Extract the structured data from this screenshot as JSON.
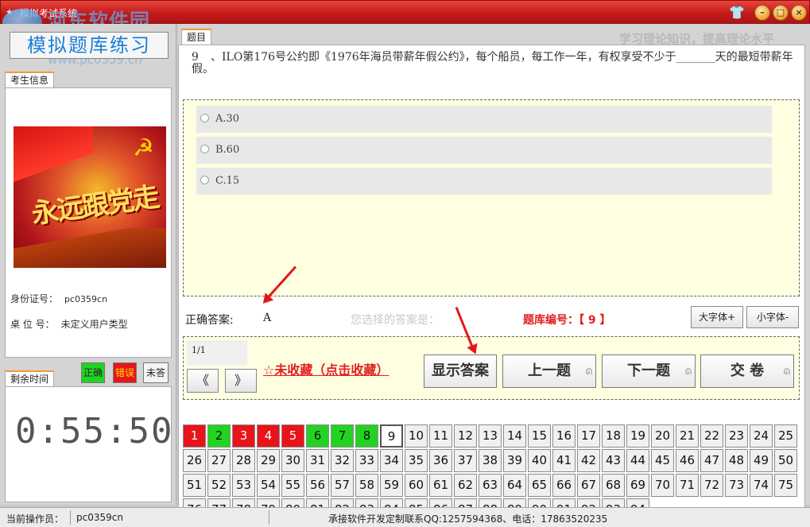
{
  "window": {
    "title": "模拟考试系统"
  },
  "watermark": {
    "main": "河东软件园",
    "sub": "www.pc0359.cn"
  },
  "header": {
    "mode_label": "模拟题库练习",
    "slogan": "学习理论知识，提高理论水平"
  },
  "left": {
    "info_tab": "考生信息",
    "photo_slogan": "永远跟党走",
    "id_label": "身份证号：",
    "id_value": "pc0359cn",
    "seat_label": "桌 位 号：",
    "seat_value": "未定义用户类型",
    "legend": {
      "correct": "正确",
      "wrong": "错误",
      "unanswered": "未答"
    },
    "time_tab": "剩余时间",
    "time_remaining": "0:55:50"
  },
  "question": {
    "tab": "题目",
    "number": "9",
    "text": "、ILO第176号公约即《1976年海员带薪年假公约》，每个船员，每工作一年，有权享受不少于_______天的最短带薪年假。",
    "options": [
      {
        "key": "A",
        "label": "A.30"
      },
      {
        "key": "B",
        "label": "B.60"
      },
      {
        "key": "C",
        "label": "C.15"
      }
    ]
  },
  "answer": {
    "correct_label": "正确答案:",
    "correct_value": "A",
    "selected_label": "您选择的答案是：",
    "bank_id_text": "题库编号：【 9 】",
    "font_large": "大字体+",
    "font_small": "小字体-"
  },
  "controls": {
    "page_indicator": "1/1",
    "prev_page": "《",
    "next_page": "》",
    "favorite": "☆未收藏（点击收藏）",
    "show_answer": "显示答案",
    "prev_question": "上一题",
    "next_question": "下一题",
    "submit": "交 卷"
  },
  "grid": {
    "total": 94,
    "current": 9,
    "status": {
      "1": "wrong",
      "2": "correct",
      "3": "wrong",
      "4": "wrong",
      "5": "wrong",
      "6": "correct",
      "7": "correct",
      "8": "correct"
    }
  },
  "status_bar": {
    "operator_label": "当前操作员：",
    "operator_value": "pc0359cn",
    "contact": "承接软件开发定制联系QQ:1257594368、电话：17863520235"
  },
  "colors": {
    "titlebar": "#c0181a",
    "wrong": "#e8141a",
    "correct": "#22d422",
    "accent": "#f29a2e",
    "highlight_panel": "#fefee0"
  }
}
